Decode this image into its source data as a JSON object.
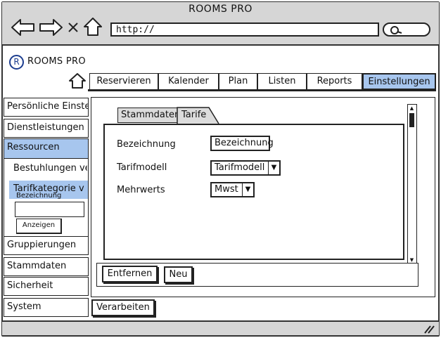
{
  "window": {
    "title": "ROOMS PRO",
    "url": "http://"
  },
  "app": {
    "logo_letter": "R",
    "name": "ROOMS PRO"
  },
  "nav": {
    "items": [
      {
        "label": "Reservieren"
      },
      {
        "label": "Kalender"
      },
      {
        "label": "Plan"
      },
      {
        "label": "Listen"
      },
      {
        "label": "Reports"
      },
      {
        "label": "Einstellungen",
        "active": true
      }
    ]
  },
  "sidebar": {
    "items": [
      {
        "label": "Persönliche Einste"
      },
      {
        "label": "Dienstleistungen"
      },
      {
        "label": "Ressourcen",
        "active": true
      },
      {
        "label": "Gruppierungen"
      },
      {
        "label": "Stammdaten"
      },
      {
        "label": "Sicherheit"
      },
      {
        "label": "System"
      }
    ],
    "subitems": [
      {
        "label": "Bestuhlungen ver"
      },
      {
        "label": "Tarifkategorie v",
        "active": true
      }
    ],
    "filter": {
      "label": "Bezeichnung",
      "value": "",
      "button": "Anzeigen"
    }
  },
  "tabs": [
    {
      "label": "Stammdaten"
    },
    {
      "label": "Tarife",
      "active": true
    }
  ],
  "form": {
    "fields": [
      {
        "label": "Bezeichnung",
        "value": "Bezeichnung"
      },
      {
        "label": "Tarifmodell",
        "value": "Tarifmodell"
      },
      {
        "label": "Mehrwerts",
        "value": "Mwst"
      }
    ]
  },
  "actions": {
    "remove": "Entfernen",
    "new": "Neu"
  },
  "footer": {
    "process": "Verarbeiten"
  },
  "colors": {
    "accent": "#a7c6ee",
    "chrome": "#d6d6d6",
    "tab_bg": "#dcdcdc",
    "logo": "#1c3d8f"
  }
}
